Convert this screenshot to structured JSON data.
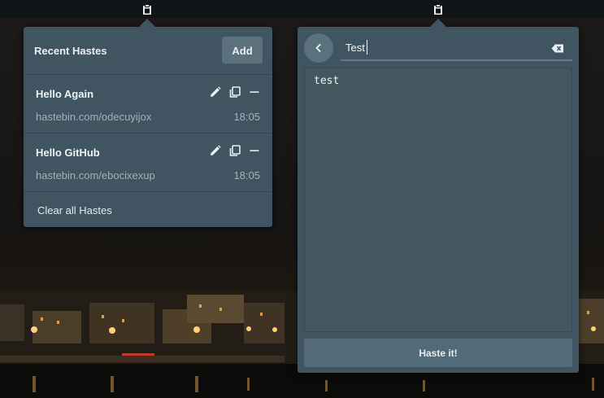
{
  "panel": {
    "indicator_icon": "clipboard-icon"
  },
  "recent": {
    "title": "Recent Hastes",
    "add_label": "Add",
    "items": [
      {
        "title": "Hello Again",
        "url": "hastebin.com/odecuyijox",
        "time": "18:05"
      },
      {
        "title": "Hello GitHub",
        "url": "hastebin.com/ebocixexup",
        "time": "18:05"
      }
    ],
    "clear_label": "Clear all Hastes"
  },
  "editor": {
    "title_value": "Test",
    "body_text": "test",
    "submit_label": "Haste it!"
  },
  "colors": {
    "popover_bg": "#40555f",
    "button_bg": "#5b727d",
    "panel_bg": "#0f1417"
  }
}
